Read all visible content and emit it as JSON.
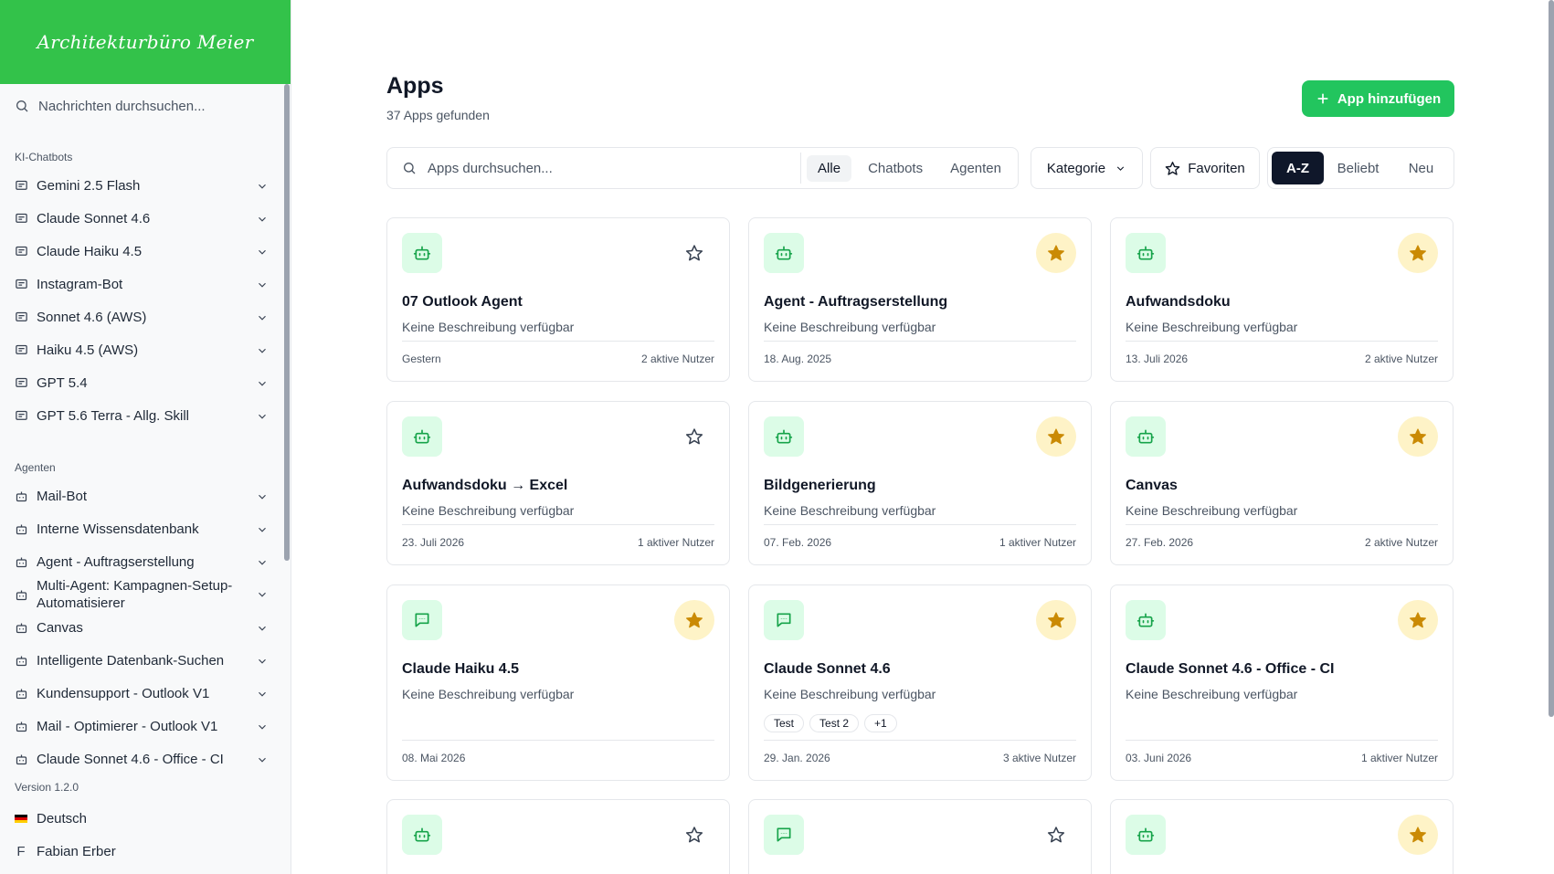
{
  "sidebar": {
    "logo": "Architekturbüro Meier",
    "search_placeholder": "Nachrichten durchsuchen...",
    "sections": {
      "chatbots": "KI-Chatbots",
      "agents": "Agenten"
    },
    "chatbots": [
      "Gemini 2.5 Flash",
      "Claude Sonnet 4.6",
      "Claude Haiku 4.5",
      "Instagram-Bot",
      "Sonnet 4.6 (AWS)",
      "Haiku 4.5 (AWS)",
      "GPT 5.4",
      "GPT 5.6 Terra - Allg. Skill"
    ],
    "agents": [
      "Mail-Bot",
      "Interne Wissensdatenbank",
      "Agent - Auftragserstellung",
      "Multi-Agent: Kampagnen-Setup-Automatisierer",
      "Canvas",
      "Intelligente Datenbank-Suchen",
      "Kundensupport - Outlook V1",
      "Mail - Optimierer - Outlook V1",
      "Claude Sonnet 4.6 - Office - CI"
    ],
    "version": "Version 1.2.0",
    "language": "Deutsch",
    "user_initial": "F",
    "user_name": "Fabian Erber"
  },
  "header": {
    "title": "Apps",
    "subtitle": "37 Apps gefunden",
    "add_button": "App hinzufügen"
  },
  "filters": {
    "search_placeholder": "Apps durchsuchen...",
    "types": [
      "Alle",
      "Chatbots",
      "Agenten"
    ],
    "active_type": "Alle",
    "category": "Kategorie",
    "favorites": "Favoriten",
    "sort": [
      "A-Z",
      "Beliebt",
      "Neu"
    ],
    "active_sort": "A-Z"
  },
  "cards": [
    {
      "title": "07 Outlook Agent",
      "desc": "Keine Beschreibung verfügbar",
      "date": "Gestern",
      "users": "2 aktive Nutzer",
      "icon": "bot-icon",
      "favorite": false,
      "tags": []
    },
    {
      "title": "Agent - Auftragserstellung",
      "desc": "Keine Beschreibung verfügbar",
      "date": "18. Aug. 2025",
      "users": "",
      "icon": "bot-icon",
      "favorite": true,
      "tags": []
    },
    {
      "title": "Aufwandsdoku",
      "desc": "Keine Beschreibung verfügbar",
      "date": "13. Juli 2026",
      "users": "2 aktive Nutzer",
      "icon": "bot-icon",
      "favorite": true,
      "tags": []
    },
    {
      "title": "Aufwandsdoku → Excel",
      "desc": "Keine Beschreibung verfügbar",
      "date": "23. Juli 2026",
      "users": "1 aktiver Nutzer",
      "icon": "bot-icon",
      "favorite": false,
      "tags": []
    },
    {
      "title": "Bildgenerierung",
      "desc": "Keine Beschreibung verfügbar",
      "date": "07. Feb. 2026",
      "users": "1 aktiver Nutzer",
      "icon": "bot-icon",
      "favorite": true,
      "tags": []
    },
    {
      "title": "Canvas",
      "desc": "Keine Beschreibung verfügbar",
      "date": "27. Feb. 2026",
      "users": "2 aktive Nutzer",
      "icon": "bot-icon",
      "favorite": true,
      "tags": []
    },
    {
      "title": "Claude Haiku 4.5",
      "desc": "Keine Beschreibung verfügbar",
      "date": "08. Mai 2026",
      "users": "",
      "icon": "chat-icon",
      "favorite": true,
      "tags": []
    },
    {
      "title": "Claude Sonnet 4.6",
      "desc": "Keine Beschreibung verfügbar",
      "date": "29. Jan. 2026",
      "users": "3 aktive Nutzer",
      "icon": "chat-icon",
      "favorite": true,
      "tags": [
        "Test",
        "Test 2",
        "+1"
      ]
    },
    {
      "title": "Claude Sonnet 4.6 - Office - CI",
      "desc": "Keine Beschreibung verfügbar",
      "date": "03. Juni 2026",
      "users": "1 aktiver Nutzer",
      "icon": "bot-icon",
      "favorite": true,
      "tags": []
    },
    {
      "title": "",
      "desc": "",
      "date": "",
      "users": "",
      "icon": "bot-icon",
      "favorite": false,
      "tags": []
    },
    {
      "title": "",
      "desc": "",
      "date": "",
      "users": "",
      "icon": "chat-icon",
      "favorite": false,
      "tags": []
    },
    {
      "title": "",
      "desc": "",
      "date": "",
      "users": "",
      "icon": "bot-icon",
      "favorite": true,
      "tags": []
    }
  ],
  "colors": {
    "brand_green": "#33c24a",
    "button_green": "#22c55e",
    "icon_green": "#16a34a",
    "icon_bg": "#dcfce7",
    "star_gold": "#ca8a04",
    "star_bg": "#fef3c7",
    "sort_active_bg": "#0f172a"
  }
}
